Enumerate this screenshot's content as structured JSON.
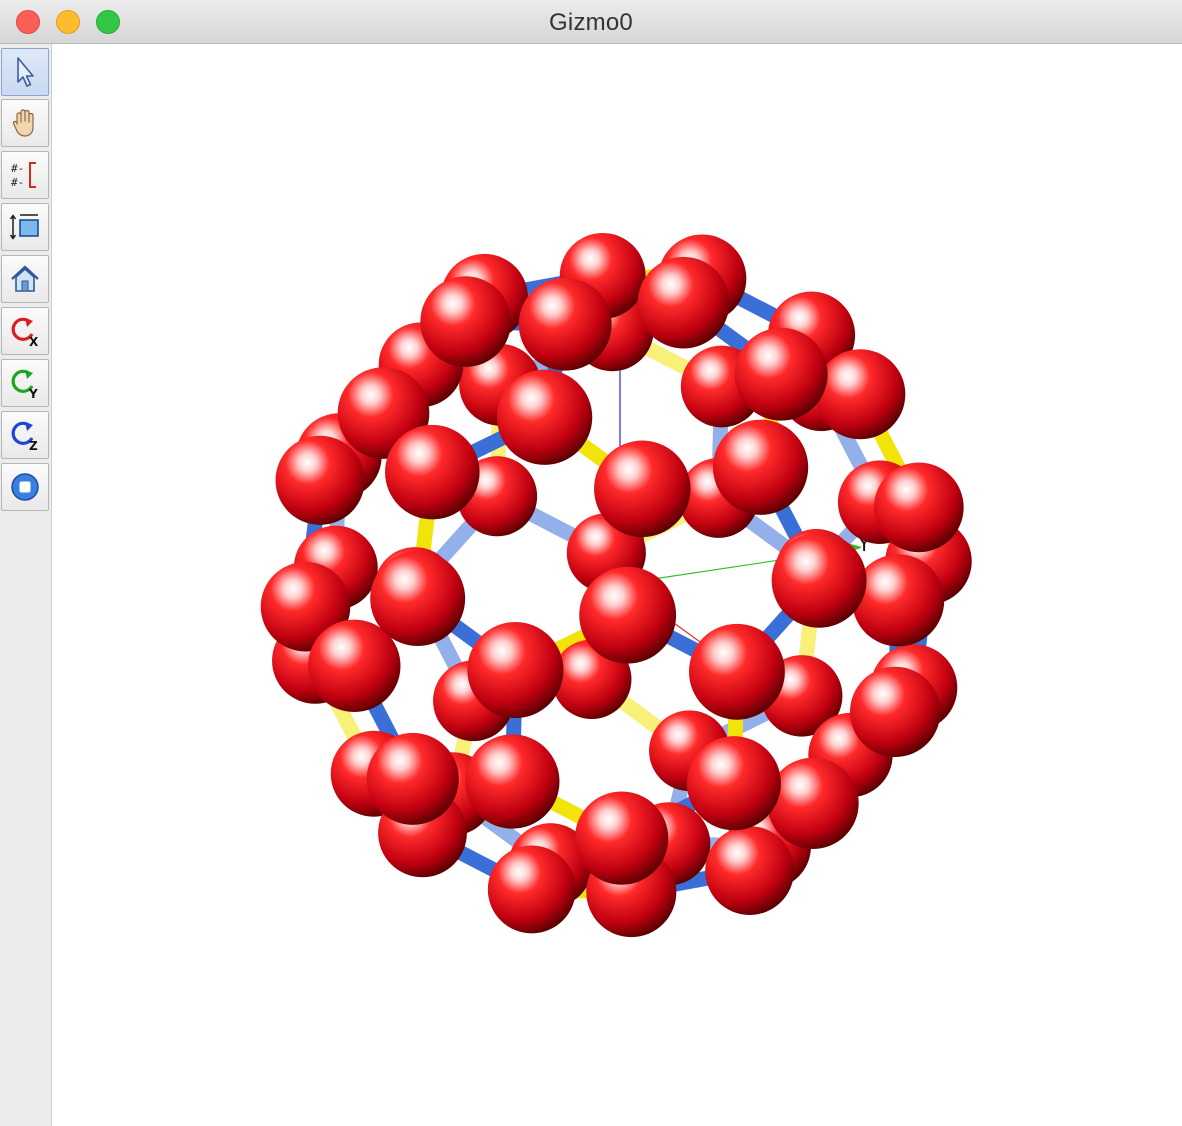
{
  "window": {
    "title": "Gizmo0"
  },
  "toolbar": {
    "tools": [
      {
        "name": "select-tool",
        "icon": "cursor-arrow-icon"
      },
      {
        "name": "pan-tool",
        "icon": "hand-icon"
      },
      {
        "name": "measure-tool",
        "icon": "measure-bracket-icon"
      },
      {
        "name": "fit-view-tool",
        "icon": "fit-frame-icon"
      },
      {
        "name": "home-view-tool",
        "icon": "home-icon"
      },
      {
        "name": "rotate-x-tool",
        "icon": "rotate-x-icon"
      },
      {
        "name": "rotate-y-tool",
        "icon": "rotate-y-icon"
      },
      {
        "name": "rotate-z-tool",
        "icon": "rotate-z-icon"
      },
      {
        "name": "stop-tool",
        "icon": "stop-icon"
      }
    ]
  },
  "scene": {
    "axes": {
      "x": "X",
      "y": "Y",
      "z": "Z"
    },
    "colors": {
      "atom": "#d01020",
      "single_bond": "#3a6fd8",
      "double_bond": "#f2e40a",
      "x_axis": "#e0302a",
      "y_axis": "#2cc02c",
      "z_axis": "#2a2ad8"
    }
  }
}
